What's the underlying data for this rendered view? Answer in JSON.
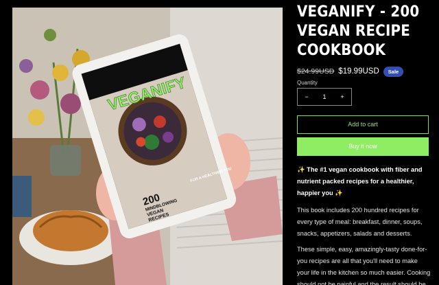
{
  "product": {
    "title": "VEGANIFY - 200 VEGAN RECIPE COOKBOOK",
    "price_old": "$24.99USD",
    "price_new": "$19.99USD",
    "sale_badge": "Sale",
    "quantity_label": "Quantity",
    "quantity_value": "1",
    "decrease_symbol": "−",
    "increase_symbol": "+",
    "add_to_cart": "Add to cart",
    "buy_now": "Buy it now",
    "description": [
      "✨ The #1 vegan cookbook with fiber and nutrient packed recipes for a healthier, happier you ✨",
      "This book includes 200 hundred recipes for every type of meal: breakfast, dinner, soups, snacks, appetizers, salads and desserts.",
      "These simple, easy, amazingly-tasty done-for-you recipes are all that you'll need to make your life in the kitchen so much easier. Cooking should not be painful and the result should be"
    ]
  },
  "image": {
    "cover_title": "VEGANIFY",
    "cover_subtitle_1": "200",
    "cover_subtitle_2": "MINDBLOWING",
    "cover_subtitle_3": "VEGAN",
    "cover_subtitle_4": "RECIPES",
    "cover_tagline": "FOR A HEALTHIER YOU"
  },
  "colors": {
    "background": "#000000",
    "accent_green": "#8fed64",
    "sale_badge": "#334fb4"
  }
}
